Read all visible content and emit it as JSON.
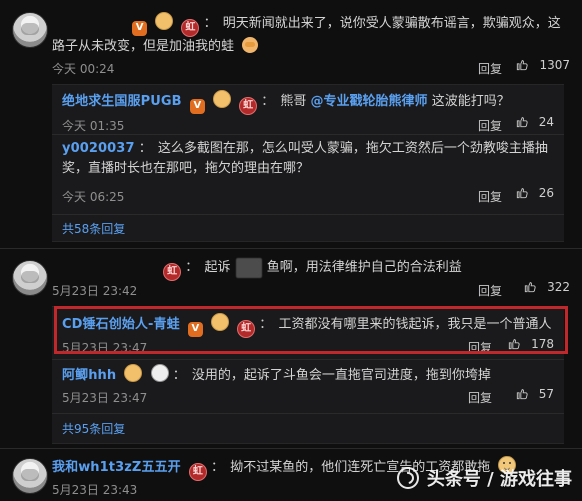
{
  "comments": [
    {
      "name": "",
      "text": "明天新闻就出来了，说你受人蒙骗散布谣言，欺骗观众，这路子从未改变，但是加油我的蛙",
      "time": "今天 00:24",
      "reply_label": "回复",
      "likes": "1307"
    },
    {
      "name": "",
      "text": "起诉",
      "text_after": "鱼啊，用法律维护自己的合法利益",
      "time": "5月23日 23:42",
      "reply_label": "回复",
      "likes": "322"
    },
    {
      "name": "我和wh1t3zZ五五开",
      "text": "拗不过某鱼的，他们连死亡宣告的工资都敢拖",
      "time": "5月23日 23:43"
    }
  ],
  "replies_1": [
    {
      "name": "绝地求生国服PUGB",
      "text_prefix": "熊哥",
      "mention": "@专业戳轮胎熊律师",
      "text_suffix": "这波能打吗？",
      "time": "今天 01:35",
      "reply_label": "回复",
      "likes": "24"
    },
    {
      "name": "y0020037",
      "text": "这么多截图在那，怎么叫受人蒙骗，拖欠工资然后一个劲教唆主播抽奖，直播时长也在那吧，拖欠的理由在哪？",
      "time": "今天 06:25",
      "reply_label": "回复",
      "likes": "26"
    }
  ],
  "more_1": "共58条回复",
  "replies_2": [
    {
      "name": "CD锤石创始人-青蛙",
      "text": "工资都没有哪里来的钱起诉，我只是一个普通人",
      "time": "5月23日 23:47",
      "reply_label": "回复",
      "likes": "178"
    },
    {
      "name": "阿鲫hhh",
      "text": "没用的，起诉了斗鱼会一直拖官司进度，拖到你垮掉",
      "time": "5月23日 23:47",
      "reply_label": "回复",
      "likes": "57"
    }
  ],
  "more_2": "共95条回复",
  "badges": {
    "v": "V",
    "red": "虹"
  },
  "watermark": "头条号 / 游戏往事"
}
